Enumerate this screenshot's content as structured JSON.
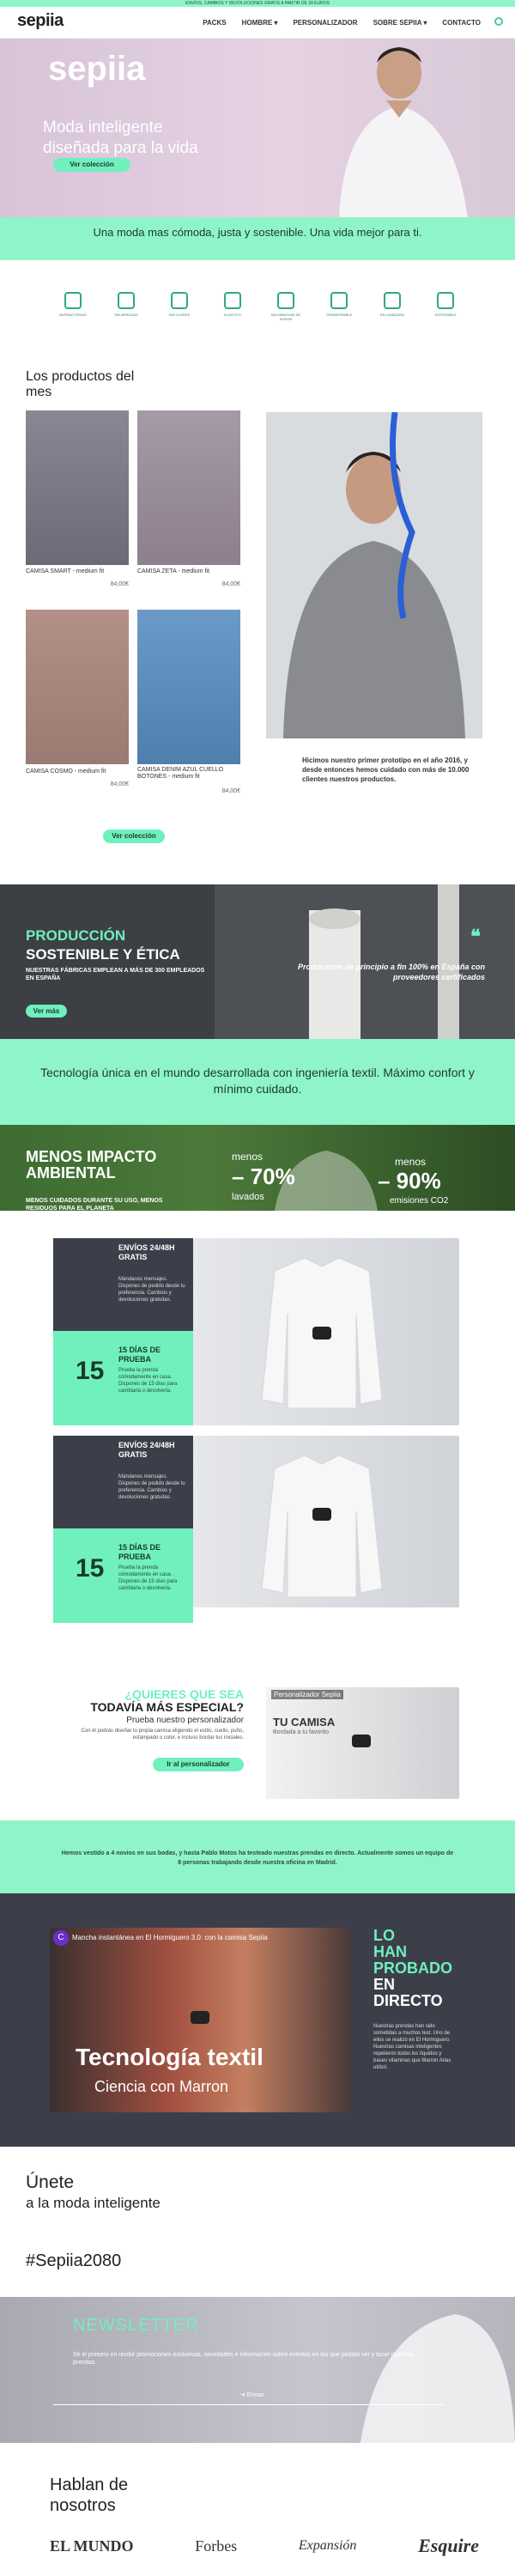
{
  "topbar": {
    "text": "ENVÍOS, CAMBIOS Y DEVOLUCIONES GRATIS A PARTIR DE 39 EUROS"
  },
  "nav": {
    "logo": "sepiia",
    "links": [
      "PACKS",
      "HOMBRE ▾",
      "PERSONALIZADOR",
      "SOBRE SEPIIA ▾",
      "CONTACTO"
    ]
  },
  "hero": {
    "logo": "sepiia",
    "title": "Moda inteligente diseñada para la vida",
    "cta": "Ver colección"
  },
  "tagline": "Una moda mas cómoda, justa y sostenible. Una vida mejor para ti.",
  "features": [
    "ANTIBACTERIAS",
    "SIN ARRUGAS",
    "SIN OLORES",
    "ELÁSTICO",
    "SIN MANCHAS DE SUDOR",
    "TRANSPIRABLE",
    "EN LAVADORA",
    "SOSTENIBLE"
  ],
  "products": {
    "title": "Los productos del mes",
    "items": [
      {
        "name": "CAMISA SMART - medium fit",
        "price": "84,00€"
      },
      {
        "name": "CAMISA ZETA - medium fit",
        "price": "84,00€"
      },
      {
        "name": "CAMISA COSMO - medium fit",
        "price": "84,00€"
      },
      {
        "name": "CAMISA DENIM AZUL CUELLO BOTONES - medium fit",
        "price": "84,00€"
      }
    ],
    "note": "Hicimos nuestro primer prototipo en el año 2016, y desde entonces hemos cuidado con más de 10.000 clientes nuestros productos.",
    "cta": "Ver colección"
  },
  "production": {
    "h1": "PRODUCCIÓN",
    "h2": "SOSTENIBLE Y ÉTICA",
    "sub": "NUESTRAS FÁBRICAS EMPLEAN A MÁS DE 300 EMPLEADOS EN ESPAÑA",
    "cta": "Ver más",
    "quote": "Producimos de principio a fin 100% en España con proveedores certificados"
  },
  "tech": "Tecnología única en el mundo desarrollada con ingeniería textil. Máximo confort y mínimo cuidado.",
  "impact": {
    "h": "MENOS IMPACTO AMBIENTAL",
    "sub": "MENOS CUIDADOS DURANTE SU USO, MENOS RESIDUOS PARA EL PLANETA",
    "stat1_label": "menos",
    "stat1": "– 70%",
    "stat1_unit": "lavados",
    "stat2_label": "menos",
    "stat2": "– 90%",
    "stat2_unit": "emisiones CO2"
  },
  "cards": [
    {
      "title": "ENVÍOS 24/48H GRATIS",
      "text": "Mándanos mensajes. Dispones de pedido desde tu preferencia. Cambios y devoluciones gratuitas."
    },
    {
      "title": "15 DÍAS DE PRUEBA",
      "text": "Prueba la prenda cómodamente en casa. Dispones de 15 días para cambiarla o devolverla."
    },
    {
      "title": "ENVÍOS 24/48H GRATIS",
      "text": "Mándanos mensajes. Dispones de pedido desde tu preferencia. Cambios y devoluciones gratuitas."
    },
    {
      "title": "15 DÍAS DE PRUEBA",
      "text": "Prueba la prenda cómodamente en casa. Dispones de 15 días para cambiarla o devolverla."
    }
  ],
  "card_number": "15",
  "personalizer": {
    "t1": "¿QUIERES QUE SEA",
    "t2": "TODAVÍA MÁS ESPECIAL?",
    "sub": "Prueba nuestro personalizador",
    "text": "Con él podrás diseñar tu propia camisa eligiendo el estilo, cuello, puño, estampado o color, e incluso bordar tus iniciales.",
    "cta": "Ir al personalizador",
    "video_title": "Personalizador Sepiia",
    "video_overlay": "TU CAMISA",
    "video_sub": "Bordada a tu favorito"
  },
  "story": "Hemos vestido a 4 novios en sus bodas, y hasta Pablo Motos ha testeado nuestras prendas en directo. Actualmente somos un equipo de 8 personas trabajando desde nuestra oficina en Madrid.",
  "live": {
    "video_title": "Mancha instantánea en El Hormiguero 3.0: con la camisa Sepiia",
    "tv_title": "Tecnología textil",
    "tv_sub": "Ciencia con Marron",
    "h1": "LO HAN PROBADO",
    "h2": "EN DIRECTO",
    "text": "Nuestras prendas han sido sometidas a muchos test. Uno de ellos se realizó en El Hormiguero. Nuestras camisas inteligentes repelieron todos los líquidos y bases vitaminas que Marron Arias utilizó."
  },
  "join": {
    "t1": "Únete",
    "t2": "a la moda inteligente",
    "hashtag": "#Sepiia2080"
  },
  "newsletter": {
    "title": "NEWSLETTER",
    "text": "Sé el primero en recibir promociones exclusivas, novedades e información sobre eventos en los que podrás ver y tocar nuestras prendas.",
    "cta": "➜ Enviar"
  },
  "press": {
    "title": "Hablan de nosotros",
    "logos": [
      "EL MUNDO",
      "Forbes",
      "Expansión",
      "Esquire"
    ]
  }
}
